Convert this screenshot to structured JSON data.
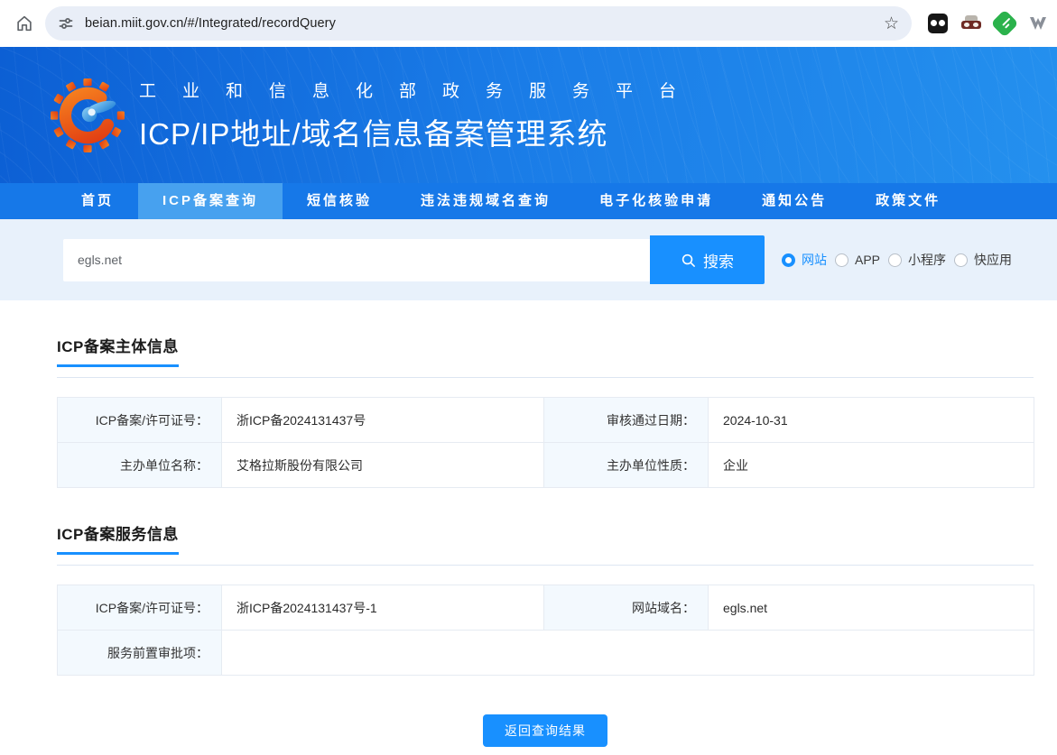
{
  "browser": {
    "url": "beian.miit.gov.cn/#/Integrated/recordQuery",
    "bookmark_star_glyph": "☆"
  },
  "header": {
    "platform_line": "工业和信息化部政务服务平台",
    "system_title": "ICP/IP地址/域名信息备案管理系统"
  },
  "nav": {
    "items": [
      "首页",
      "ICP备案查询",
      "短信核验",
      "违法违规域名查询",
      "电子化核验申请",
      "通知公告",
      "政策文件"
    ],
    "active_item": "ICP备案查询"
  },
  "search": {
    "query": "egls.net",
    "button_label": "搜索",
    "options": [
      {
        "label": "网站",
        "selected": true
      },
      {
        "label": "APP",
        "selected": false
      },
      {
        "label": "小程序",
        "selected": false
      },
      {
        "label": "快应用",
        "selected": false
      }
    ]
  },
  "subject_info": {
    "title": "ICP备案主体信息",
    "rows": [
      [
        {
          "label": "ICP备案/许可证号：",
          "value": "浙ICP备2024131437号"
        },
        {
          "label": "审核通过日期：",
          "value": "2024-10-31"
        }
      ],
      [
        {
          "label": "主办单位名称：",
          "value": "艾格拉斯股份有限公司"
        },
        {
          "label": "主办单位性质：",
          "value": "企业"
        }
      ]
    ]
  },
  "service_info": {
    "title": "ICP备案服务信息",
    "rows": [
      [
        {
          "label": "ICP备案/许可证号：",
          "value": "浙ICP备2024131437号-1"
        },
        {
          "label": "网站域名：",
          "value": "egls.net"
        }
      ]
    ],
    "full_row": {
      "label": "服务前置审批项：",
      "value": ""
    }
  },
  "footer": {
    "back_button_label": "返回查询结果"
  },
  "colors": {
    "accent": "#1890ff",
    "nav_bar": "#1678e8",
    "nav_active": "#47a1ef",
    "search_band_bg": "#e8f1fb",
    "label_cell_bg": "#f3f9fe",
    "header_gradient_start": "#0c5fd4",
    "header_gradient_end": "#2490ee",
    "logo_orange": "#e8491f",
    "logo_blue": "#1d7fd6"
  }
}
